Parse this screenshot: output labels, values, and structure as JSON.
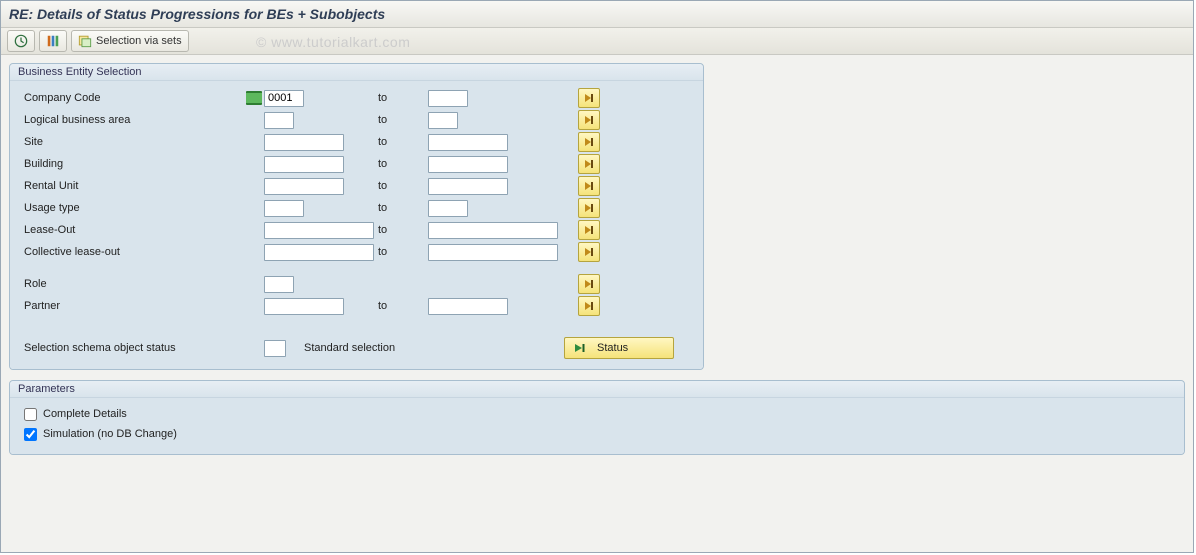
{
  "page_title": "RE: Details of Status Progressions for BEs + Subobjects",
  "watermark": "© www.tutorialkart.com",
  "toolbar": {
    "execute_tip": "Execute",
    "variants_tip": "Get Variant",
    "selection_via_sets_label": "Selection via sets"
  },
  "group1": {
    "title": "Business Entity Selection",
    "to_label": "to",
    "rows": {
      "company_code": {
        "label": "Company Code",
        "from": "0001",
        "to": ""
      },
      "logical_business_area": {
        "label": "Logical business area",
        "from": "",
        "to": ""
      },
      "site": {
        "label": "Site",
        "from": "",
        "to": ""
      },
      "building": {
        "label": "Building",
        "from": "",
        "to": ""
      },
      "rental_unit": {
        "label": "Rental Unit",
        "from": "",
        "to": ""
      },
      "usage_type": {
        "label": "Usage type",
        "from": "",
        "to": ""
      },
      "lease_out": {
        "label": "Lease-Out",
        "from": "",
        "to": ""
      },
      "collective_lease_out": {
        "label": "Collective lease-out",
        "from": "",
        "to": ""
      },
      "role": {
        "label": "Role",
        "from": ""
      },
      "partner": {
        "label": "Partner",
        "from": "",
        "to": ""
      }
    },
    "schema_label": "Selection schema object status",
    "schema_value": "",
    "standard_selection_label": "Standard selection",
    "status_btn_label": "Status"
  },
  "group2": {
    "title": "Parameters",
    "complete_details_label": "Complete Details",
    "complete_details_checked": false,
    "simulation_label": "Simulation (no DB Change)",
    "simulation_checked": true
  }
}
